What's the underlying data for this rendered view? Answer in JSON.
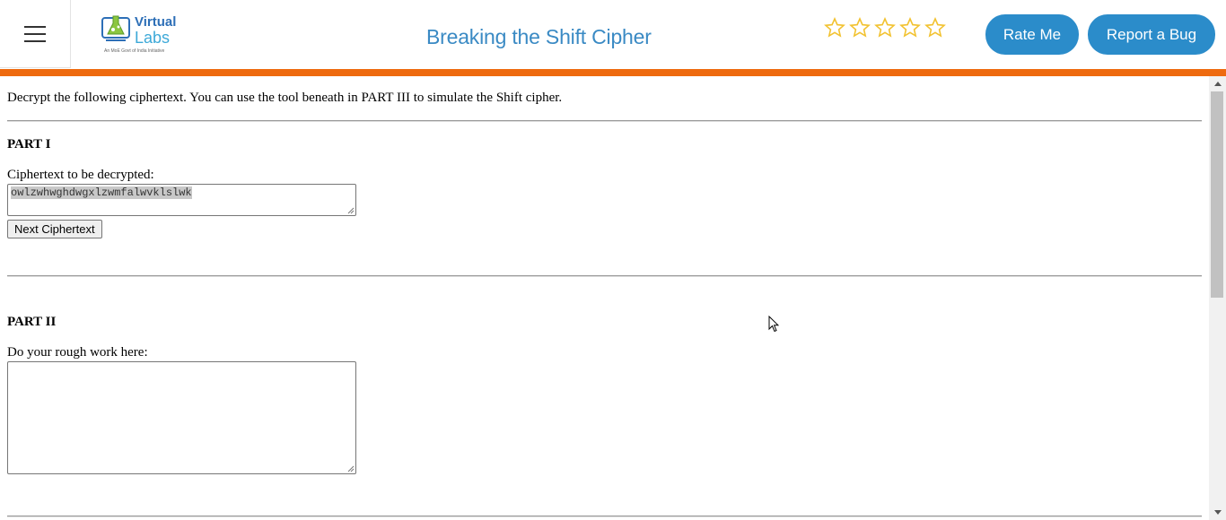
{
  "header": {
    "menu_icon": "hamburger-menu-icon",
    "logo": {
      "line1": "Virtual",
      "line2": "Labs",
      "tagline": "An MoE Govt of India Initiative"
    },
    "title": "Breaking the Shift Cipher",
    "rating": {
      "stars_total": 5,
      "stars_filled": 0,
      "star_color": "#f2c230"
    },
    "rate_button": "Rate Me",
    "bug_button": "Report a Bug",
    "accent_color": "#ee6a0f",
    "button_color": "#2b8cca"
  },
  "main": {
    "intro": "Decrypt the following ciphertext. You can use the tool beneath in PART III to simulate the Shift cipher.",
    "part1": {
      "heading": "PART I",
      "label": "Ciphertext to be decrypted:",
      "ciphertext": "owlzwhwghdwgxlzwmfalwvklslwk",
      "next_button": "Next Ciphertext"
    },
    "part2": {
      "heading": "PART II",
      "label": "Do your rough work here:",
      "rough_work": ""
    }
  }
}
